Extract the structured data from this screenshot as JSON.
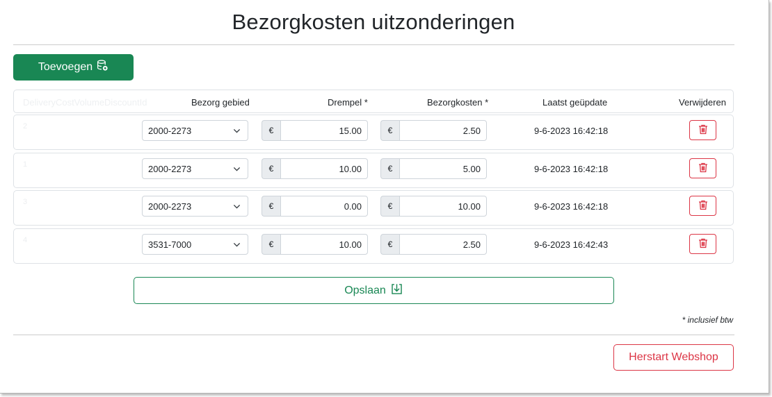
{
  "title": "Bezorgkosten uitzonderingen",
  "add_button": {
    "label": "Toevoegen",
    "icon": "database-add-icon"
  },
  "table": {
    "ghost_header": "DeliveryCostVolumeDiscountId",
    "headers": {
      "area": "Bezorg gebied",
      "threshold": "Drempel *",
      "cost": "Bezorgkosten *",
      "updated": "Laatst geüpdate",
      "delete": "Verwijderen"
    },
    "currency": "€",
    "rows": [
      {
        "id": "2",
        "area": "2000-2273",
        "threshold": "15.00",
        "cost": "2.50",
        "updated": "9-6-2023 16:42:18"
      },
      {
        "id": "1",
        "area": "2000-2273",
        "threshold": "10.00",
        "cost": "5.00",
        "updated": "9-6-2023 16:42:18"
      },
      {
        "id": "3",
        "area": "2000-2273",
        "threshold": "0.00",
        "cost": "10.00",
        "updated": "9-6-2023 16:42:18"
      },
      {
        "id": "4",
        "area": "3531-7000",
        "threshold": "10.00",
        "cost": "2.50",
        "updated": "9-6-2023 16:42:43"
      }
    ]
  },
  "save_button": {
    "label": "Opslaan",
    "icon": "download-box-icon"
  },
  "footnote": "* inclusief btw",
  "restart_button": {
    "label": "Herstart Webshop"
  },
  "colors": {
    "success": "#198754",
    "danger": "#dc3545",
    "border": "#dee2e6",
    "addon_bg": "#e9ecef"
  }
}
